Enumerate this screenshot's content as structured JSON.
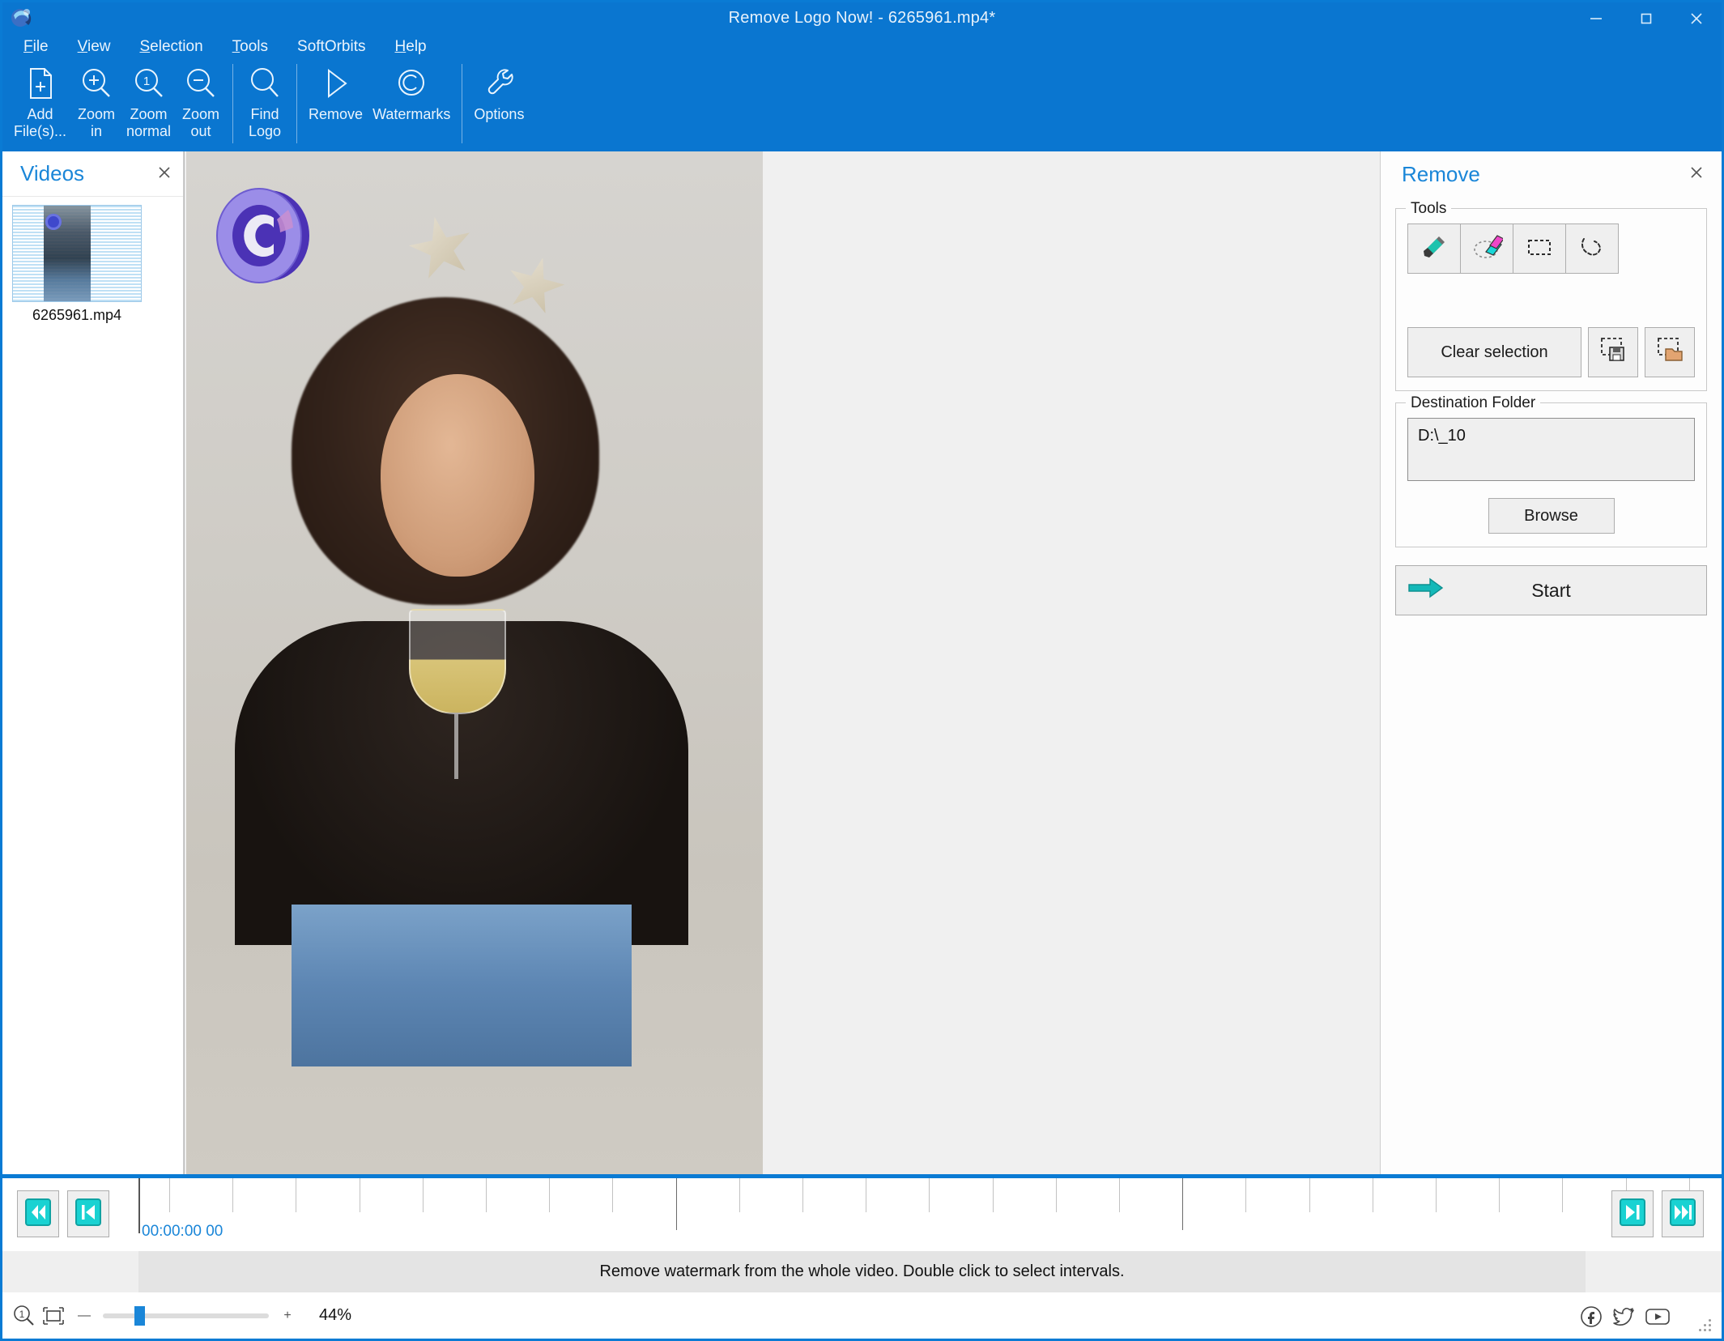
{
  "window": {
    "title": "Remove Logo Now! - 6265961.mp4*",
    "minimize_label": "Minimize",
    "maximize_label": "Maximize",
    "close_label": "Close",
    "accent_color": "#0a76d0",
    "link_color": "#1a86d8",
    "teal_color": "#1ad1d1"
  },
  "menubar": {
    "items": [
      {
        "pre": "",
        "mn": "F",
        "post": "ile"
      },
      {
        "pre": "",
        "mn": "V",
        "post": "iew"
      },
      {
        "pre": "",
        "mn": "S",
        "post": "election"
      },
      {
        "pre": "",
        "mn": "T",
        "post": "ools"
      },
      {
        "pre": "SoftOrbits",
        "mn": "",
        "post": ""
      },
      {
        "pre": "",
        "mn": "H",
        "post": "elp"
      }
    ]
  },
  "ribbon": {
    "add_files": {
      "label": "Add\nFile(s)...",
      "icon": "document-add-icon"
    },
    "zoom_in": {
      "label": "Zoom\nin",
      "icon": "zoom-in-icon"
    },
    "zoom_normal": {
      "label": "Zoom\nnormal",
      "icon": "zoom-normal-icon"
    },
    "zoom_out": {
      "label": "Zoom\nout",
      "icon": "zoom-out-icon"
    },
    "find_logo": {
      "label": "Find\nLogo",
      "icon": "magnifier-icon"
    },
    "remove": {
      "label": "Remove",
      "icon": "play-triangle-icon"
    },
    "watermarks": {
      "label": "Watermarks",
      "icon": "copyright-icon"
    },
    "options": {
      "label": "Options",
      "icon": "wrench-icon"
    }
  },
  "videos_panel": {
    "title": "Videos",
    "close_icon": "close-icon",
    "items": [
      {
        "filename": "6265961.mp4"
      }
    ]
  },
  "remove_panel": {
    "title": "Remove",
    "close_icon": "close-icon",
    "tools_group": {
      "legend": "Tools",
      "tools": [
        {
          "name": "marker-tool",
          "icon": "marker-icon"
        },
        {
          "name": "eraser-tool",
          "icon": "eraser-icon"
        },
        {
          "name": "rectangle-select-tool",
          "icon": "rectangle-select-icon"
        },
        {
          "name": "lasso-select-tool",
          "icon": "lasso-icon"
        }
      ],
      "clear_selection_label": "Clear selection",
      "save_selection_icon": "save-selection-icon",
      "load_selection_icon": "load-selection-icon"
    },
    "destination_group": {
      "legend": "Destination Folder",
      "path_value": "D:\\_10",
      "path_placeholder": "",
      "browse_label": "Browse"
    },
    "start_label": "Start",
    "start_icon": "arrow-right-icon"
  },
  "timeline": {
    "first_frame_icon": "skip-to-start-icon",
    "prev_frame_icon": "step-back-icon",
    "next_frame_icon": "step-forward-icon",
    "last_frame_icon": "skip-to-end-icon",
    "current_time": "00:00:00 00",
    "tick_count": 25,
    "major_tick_indexes": [
      8,
      16
    ]
  },
  "statusbar": {
    "message": "Remove watermark from the whole video. Double click to select intervals."
  },
  "zoombar": {
    "zoom_one_icon": "zoom-actual-size-icon",
    "fit_icon": "fit-to-window-icon",
    "minus_label": "—",
    "plus_label": "+",
    "zoom_percent": "44%",
    "slider_position_pct": 22,
    "social": [
      {
        "name": "facebook-icon",
        "label": "f"
      },
      {
        "name": "twitter-icon",
        "label": "t"
      },
      {
        "name": "youtube-icon",
        "label": "y"
      }
    ]
  },
  "canvas": {
    "watermark_icon": "copyright-watermark",
    "watermark_colors": {
      "light": "#9b8de8",
      "dark": "#4b32b5",
      "highlight": "#d9a0d8"
    }
  }
}
